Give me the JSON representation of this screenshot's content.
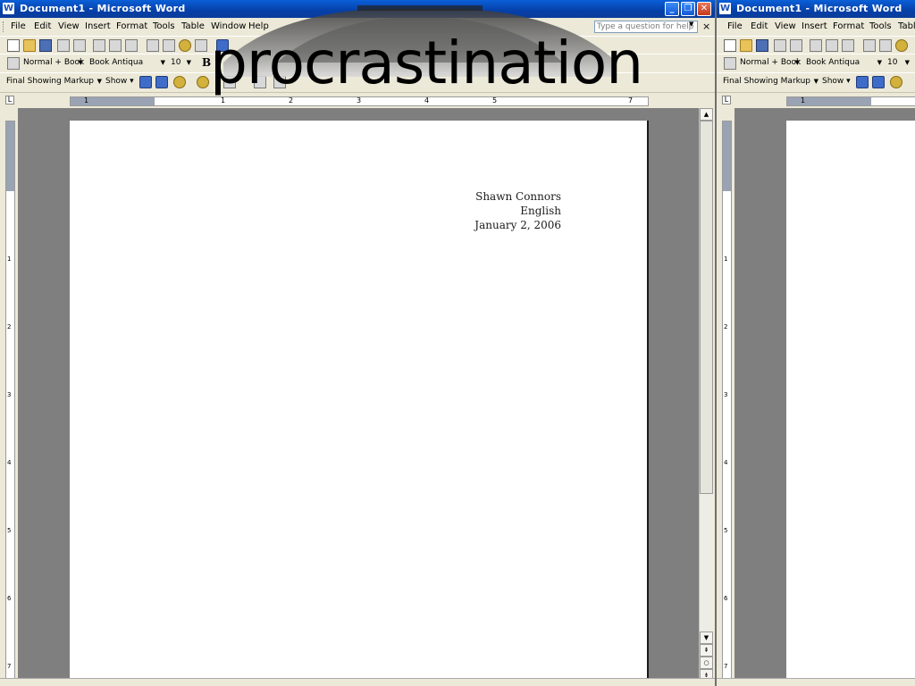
{
  "window": {
    "title": "Document1 - Microsoft Word",
    "app_icon": "W",
    "minimize": "_",
    "restore": "❐",
    "close": "✕"
  },
  "menu": {
    "items": [
      {
        "label": "File"
      },
      {
        "label": "Edit"
      },
      {
        "label": "View"
      },
      {
        "label": "Insert"
      },
      {
        "label": "Format"
      },
      {
        "label": "Tools"
      },
      {
        "label": "Table"
      },
      {
        "label": "Window"
      },
      {
        "label": "Help"
      }
    ],
    "help_placeholder": "Type a question for help",
    "close_doc": "×"
  },
  "formatting": {
    "style": "Normal + Book",
    "font": "Book Antiqua",
    "size": "10",
    "bold": "B"
  },
  "reviewing": {
    "display": "Final Showing Markup",
    "show": "Show"
  },
  "ruler": {
    "numbers": [
      "1",
      "1",
      "2",
      "3",
      "4",
      "5",
      "7"
    ]
  },
  "vruler": {
    "numbers": [
      "1",
      "2",
      "3",
      "4",
      "5",
      "6",
      "7"
    ]
  },
  "document": {
    "lines": [
      "Shawn Connors",
      "English",
      "January 2, 2006"
    ]
  },
  "overlay": {
    "text": "procrastination"
  },
  "second_window": {
    "title": "Document1 - Microsoft Word",
    "menu": [
      "File",
      "Edit",
      "View",
      "Insert",
      "Format",
      "Tools",
      "Table"
    ],
    "style": "Normal + Book",
    "font": "Book Antiqua",
    "size": "10",
    "display": "Final Showing Markup",
    "show": "Show"
  }
}
